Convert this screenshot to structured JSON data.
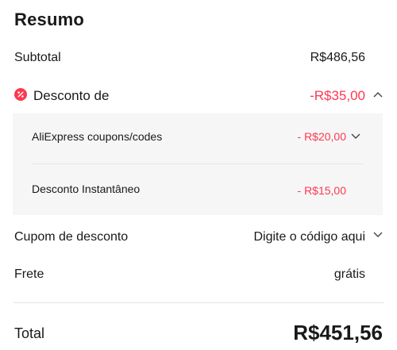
{
  "title": "Resumo",
  "subtotal": {
    "label": "Subtotal",
    "value": "R$486,56"
  },
  "discount": {
    "label": "Desconto de",
    "value": "-R$35,00",
    "items": [
      {
        "label": "AliExpress coupons/codes",
        "value": "- R$20,00"
      },
      {
        "label": "Desconto Instantâneo",
        "value": "- R$15,00"
      }
    ]
  },
  "coupon": {
    "label": "Cupom de desconto",
    "placeholder": "Digite o código aqui"
  },
  "shipping": {
    "label": "Frete",
    "value": "grátis"
  },
  "total": {
    "label": "Total",
    "value": "R$451,56"
  },
  "colors": {
    "accent_red": "#fd384f",
    "panel_bg": "#f6f6f6"
  },
  "icons": [
    "discount-badge-icon",
    "chevron-up-icon",
    "chevron-down-icon"
  ]
}
